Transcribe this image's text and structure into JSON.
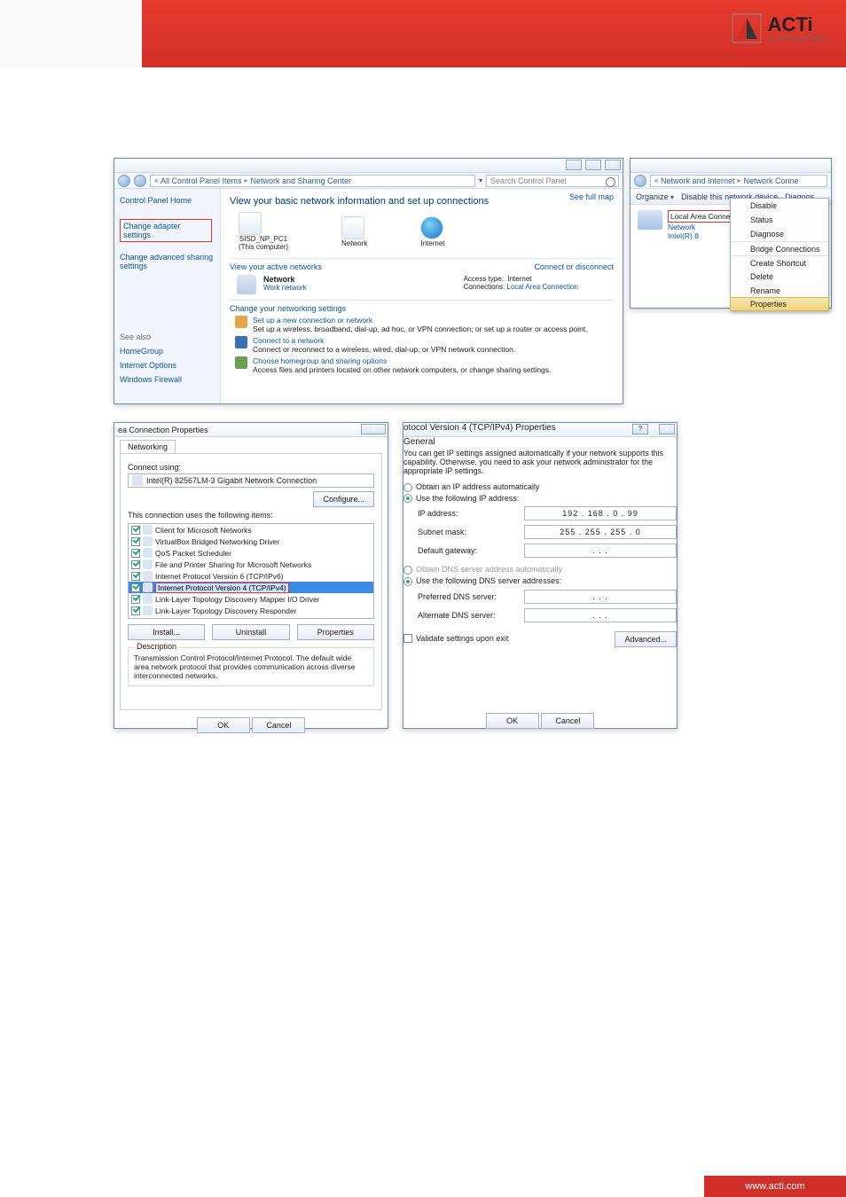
{
  "brand": {
    "name": "ACTi",
    "tagline": "Connecting Vision",
    "footer": "www.acti.com"
  },
  "win1": {
    "breadcrumb_a": "All Control Panel Items",
    "breadcrumb_b": "Network and Sharing Center",
    "search_ph": "Search Control Panel",
    "side": {
      "home": "Control Panel Home",
      "adapter": "Change adapter settings",
      "advanced": "Change advanced sharing settings",
      "seealso": "See also",
      "hg": "HomeGroup",
      "io": "Internet Options",
      "wf": "Windows Firewall"
    },
    "h1": "View your basic network information and set up connections",
    "fullmap": "See full map",
    "pc_name": "SISD_NP_PC1",
    "pc_sub": "(This computer)",
    "net_label": "Network",
    "inet_label": "Internet",
    "view_active": "View your active networks",
    "conn_disc": "Connect or disconnect",
    "net_name": "Network",
    "net_type": "Work network",
    "access_k": "Access type:",
    "access_v": "Internet",
    "conn_k": "Connections:",
    "conn_v": "Local Area Connection",
    "chg_head": "Change your networking settings",
    "t1": "Set up a new connection or network",
    "t1d": "Set up a wireless, broadband, dial-up, ad hoc, or VPN connection; or set up a router or access point.",
    "t2": "Connect to a network",
    "t2d": "Connect or reconnect to a wireless, wired, dial-up, or VPN network connection.",
    "t3": "Choose homegroup and sharing options",
    "t3d": "Access files and printers located on other network computers, or change sharing settings."
  },
  "win2": {
    "bc_a": "Network and Internet",
    "bc_b": "Network Conne",
    "organize": "Organize",
    "disable": "Disable this network device",
    "diagnos": "Diagnos",
    "adapter_name": "Local Area Connection",
    "adapter_sub": "Network",
    "adapter_dev": "Intel(R) 8",
    "ctx": {
      "disable": "Disable",
      "status": "Status",
      "diagnose": "Diagnose",
      "bridge": "Bridge Connections",
      "shortcut": "Create Shortcut",
      "delete": "Delete",
      "rename": "Rename",
      "properties": "Properties"
    }
  },
  "win3": {
    "title": "ea Connection Properties",
    "tab": "Networking",
    "connect_using": "Connect using:",
    "nic": "Intel(R) 82567LM-3 Gigabit Network Connection",
    "configure": "Configure...",
    "this_uses": "This connection uses the following items:",
    "items": [
      "Client for Microsoft Networks",
      "VirtualBox Bridged Networking Driver",
      "QoS Packet Scheduler",
      "File and Printer Sharing for Microsoft Networks",
      "Internet Protocol Version 6 (TCP/IPv6)",
      "Internet Protocol Version 4 (TCP/IPv4)",
      "Link-Layer Topology Discovery Mapper I/O Driver",
      "Link-Layer Topology Discovery Responder"
    ],
    "install": "Install...",
    "uninstall": "Uninstall",
    "properties": "Properties",
    "desc_h": "Description",
    "desc": "Transmission Control Protocol/Internet Protocol. The default wide area network protocol that provides communication across diverse interconnected networks.",
    "ok": "OK",
    "cancel": "Cancel"
  },
  "win4": {
    "title": "otocol Version 4 (TCP/IPv4) Properties",
    "tab": "General",
    "intro": "You can get IP settings assigned automatically if your network supports this capability. Otherwise, you need to ask your network administrator for the appropriate IP settings.",
    "r_auto_ip": "Obtain an IP address automatically",
    "r_use_ip": "Use the following IP address:",
    "ip_k": "IP address:",
    "ip_v": "192 . 168 .   0  .  99",
    "mask_k": "Subnet mask:",
    "mask_v": "255 . 255 . 255 .  0",
    "gw_k": "Default gateway:",
    "gw_v": ".       .       .",
    "r_auto_dns": "Obtain DNS server address automatically",
    "r_use_dns": "Use the following DNS server addresses:",
    "pdns_k": "Preferred DNS server:",
    "pdns_v": ".       .       .",
    "adns_k": "Alternate DNS server:",
    "adns_v": ".       .       .",
    "validate": "Validate settings upon exit",
    "advanced": "Advanced...",
    "ok": "OK",
    "cancel": "Cancel"
  }
}
